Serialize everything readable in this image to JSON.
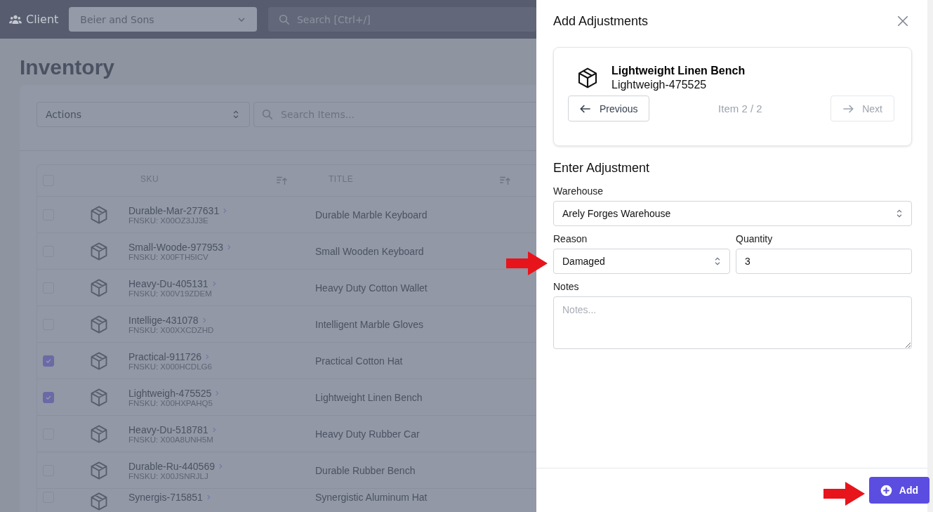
{
  "topbar": {
    "client_label": "Client",
    "client_select": "Beier and Sons",
    "search": {
      "placeholder": "Search [Ctrl+/]"
    }
  },
  "page": {
    "title": "Inventory",
    "actions_select": "Actions",
    "search": {
      "placeholder": "Search Items..."
    },
    "table": {
      "all_selected": false,
      "columns": [
        "SKU",
        "TITLE"
      ],
      "rows": [
        {
          "sku": "Durable-Mar-277631",
          "fnsku": "FNSKU: X00OZ3JJ3E",
          "title": "Durable Marble Keyboard",
          "selected": false
        },
        {
          "sku": "Small-Woode-977953",
          "fnsku": "FNSKU: X00FTH5ICV",
          "title": "Small Wooden Keyboard",
          "selected": false
        },
        {
          "sku": "Heavy-Du-405131",
          "fnsku": "FNSKU: X00V19ZDEM",
          "title": "Heavy Duty Cotton Wallet",
          "selected": false
        },
        {
          "sku": "Intellige-431078",
          "fnsku": "FNSKU: X00XXCDZHD",
          "title": "Intelligent Marble Gloves",
          "selected": false
        },
        {
          "sku": "Practical-911726",
          "fnsku": "FNSKU: X000HCDLG6",
          "title": "Practical Cotton Hat",
          "selected": true
        },
        {
          "sku": "Lightweigh-475525",
          "fnsku": "FNSKU: X00HXPAHQ5",
          "title": "Lightweight Linen Bench",
          "selected": true
        },
        {
          "sku": "Heavy-Du-518781",
          "fnsku": "FNSKU: X00A8UNH5M",
          "title": "Heavy Duty Rubber Car",
          "selected": false
        },
        {
          "sku": "Durable-Ru-440569",
          "fnsku": "FNSKU: X00JSNRJLJ",
          "title": "Durable Rubber Bench",
          "selected": false
        },
        {
          "sku": "Synergis-715851",
          "title": "Synergistic Aluminum Hat",
          "selected": false
        }
      ]
    }
  },
  "drawer": {
    "title": "Add Adjustments",
    "item": {
      "name": "Lightweight Linen Bench",
      "sku": "Lightweigh-475525"
    },
    "previous": {
      "label": "Previous",
      "disabled": false
    },
    "counter": "Item 2 / 2",
    "next": {
      "label": "Next",
      "disabled": true
    },
    "section_title": "Enter Adjustment",
    "warehouse": {
      "label": "Warehouse",
      "value": "Arely Forges Warehouse"
    },
    "reason": {
      "label": "Reason",
      "value": "Damaged"
    },
    "quantity": {
      "label": "Quantity",
      "value": "3"
    },
    "notes": {
      "label": "Notes",
      "placeholder": "Notes..."
    },
    "add_button": "Add"
  }
}
